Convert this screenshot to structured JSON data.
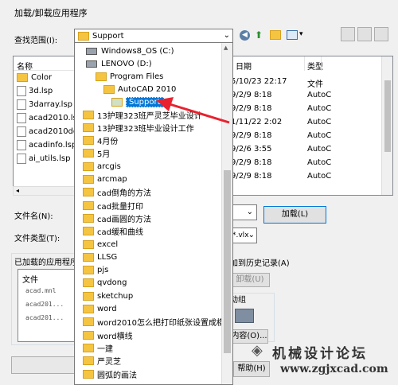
{
  "window": {
    "title": "加载/卸载应用程序"
  },
  "look_in": {
    "label": "查找范围(I):",
    "value": "Support"
  },
  "list": {
    "col_name": "名称",
    "col_date": "日期",
    "col_type": "类型",
    "files": [
      {
        "name": "Color",
        "kind": "folder"
      },
      {
        "name": "3d.lsp",
        "kind": "file"
      },
      {
        "name": "3darray.lsp",
        "kind": "file"
      },
      {
        "name": "acad2010.ls",
        "kind": "file"
      },
      {
        "name": "acad2010do",
        "kind": "file"
      },
      {
        "name": "acadinfo.lsp",
        "kind": "file"
      },
      {
        "name": "ai_utils.lsp",
        "kind": "file"
      }
    ],
    "right_rows": [
      {
        "date": "5/10/23 22:17",
        "type": "文件"
      },
      {
        "date": "9/2/9 8:18",
        "type": "AutoC"
      },
      {
        "date": "9/2/9 8:18",
        "type": "AutoC"
      },
      {
        "date": "1/11/22 2:02",
        "type": "AutoC"
      },
      {
        "date": "9/2/9 8:18",
        "type": "AutoC"
      },
      {
        "date": "9/2/6 3:55",
        "type": "AutoC"
      },
      {
        "date": "9/2/9 8:18",
        "type": "AutoC"
      },
      {
        "date": "9/2/9 8:18",
        "type": "AutoC"
      }
    ]
  },
  "dropdown": {
    "items": [
      {
        "label": "Windows8_OS (C:)",
        "kind": "drive",
        "indent": 0
      },
      {
        "label": "LENOVO (D:)",
        "kind": "drive",
        "indent": 0
      },
      {
        "label": "Program Files",
        "kind": "folder",
        "indent": 1
      },
      {
        "label": "AutoCAD 2010",
        "kind": "folder",
        "indent": 2
      },
      {
        "label": "Support",
        "kind": "folder",
        "indent": 3,
        "selected": true
      },
      {
        "label": "13护理323班严灵芝毕业设计",
        "kind": "folder",
        "indent": -1
      },
      {
        "label": "13护理323班毕业设计工作",
        "kind": "folder",
        "indent": -1
      },
      {
        "label": "4月份",
        "kind": "folder",
        "indent": -1
      },
      {
        "label": "5月",
        "kind": "folder",
        "indent": -1
      },
      {
        "label": "arcgis",
        "kind": "folder",
        "indent": -1
      },
      {
        "label": "arcmap",
        "kind": "folder",
        "indent": -1
      },
      {
        "label": "cad倒角的方法",
        "kind": "folder",
        "indent": -1
      },
      {
        "label": "cad批量打印",
        "kind": "folder",
        "indent": -1
      },
      {
        "label": "cad画圆的方法",
        "kind": "folder",
        "indent": -1
      },
      {
        "label": "cad缓和曲线",
        "kind": "folder",
        "indent": -1
      },
      {
        "label": "excel",
        "kind": "folder",
        "indent": -1
      },
      {
        "label": "LLSG",
        "kind": "folder",
        "indent": -1
      },
      {
        "label": "pjs",
        "kind": "folder",
        "indent": -1
      },
      {
        "label": "qvdong",
        "kind": "folder",
        "indent": -1
      },
      {
        "label": "sketchup",
        "kind": "folder",
        "indent": -1
      },
      {
        "label": "word",
        "kind": "folder",
        "indent": -1
      },
      {
        "label": "word2010怎么把打印纸张设置成横",
        "kind": "folder",
        "indent": -1
      },
      {
        "label": "word横线",
        "kind": "folder",
        "indent": -1
      },
      {
        "label": "一建",
        "kind": "folder",
        "indent": -1
      },
      {
        "label": "严灵芝",
        "kind": "folder",
        "indent": -1
      },
      {
        "label": "圆弧的画法",
        "kind": "folder",
        "indent": -1
      }
    ]
  },
  "filename": {
    "label": "文件名(N):"
  },
  "filetype": {
    "label": "文件类型(T):",
    "value_fragment": "*.vlx"
  },
  "load_button": "加载(L)",
  "add_history": "加到历史记录(A)",
  "unload_button": "卸载(U)",
  "loaded_apps": {
    "label": "已加载的应用程序",
    "col_file": "文件",
    "items": [
      "acad.mnl",
      "acad201...",
      "acad201..."
    ]
  },
  "startup_group": "动组",
  "contents_button": "内容(O)...",
  "help_button": "帮助(H)",
  "watermark": {
    "title": "机械设计论坛",
    "url": "www.zgjxcad.com"
  },
  "colors": {
    "accent": "#0078d7",
    "arrow": "#e8222e",
    "folder": "#f5c542"
  }
}
